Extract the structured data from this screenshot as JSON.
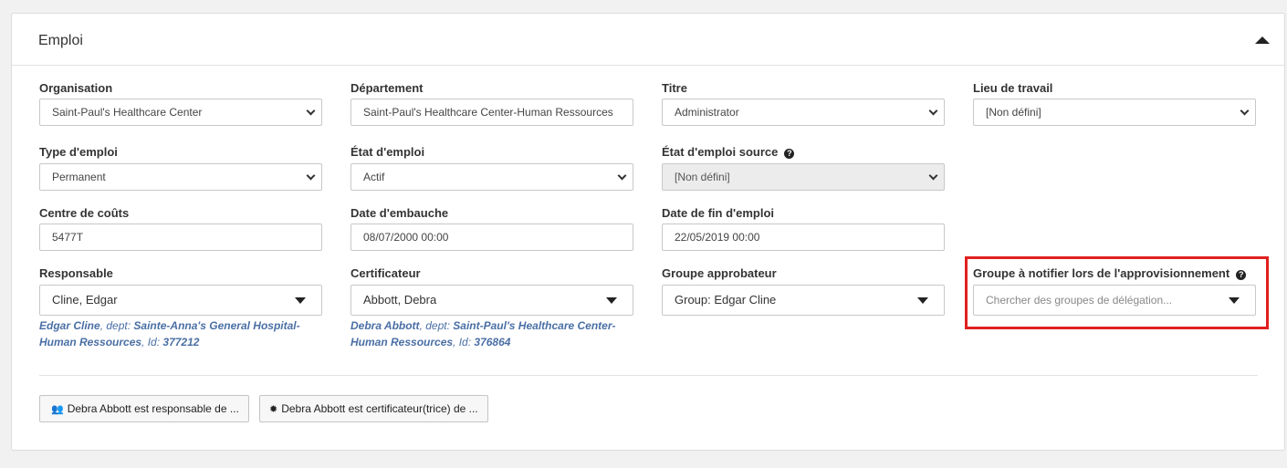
{
  "section": {
    "title": "Emploi"
  },
  "fields": {
    "organisation": {
      "label": "Organisation",
      "value": "Saint-Paul's Healthcare Center"
    },
    "departement": {
      "label": "Département",
      "value": "Saint-Paul's Healthcare Center-Human Ressources"
    },
    "titre": {
      "label": "Titre",
      "value": "Administrator"
    },
    "lieu": {
      "label": "Lieu de travail",
      "value": "[Non défini]"
    },
    "type_emploi": {
      "label": "Type d'emploi",
      "value": "Permanent"
    },
    "etat_emploi": {
      "label": "État d'emploi",
      "value": "Actif"
    },
    "etat_source": {
      "label": "État d'emploi source",
      "value": "[Non défini]"
    },
    "centre_couts": {
      "label": "Centre de coûts",
      "value": "5477T"
    },
    "date_embauche": {
      "label": "Date d'embauche",
      "value": "08/07/2000 00:00"
    },
    "date_fin": {
      "label": "Date de fin d'emploi",
      "value": "22/05/2019 00:00"
    },
    "responsable": {
      "label": "Responsable",
      "value": "Cline, Edgar",
      "info_name": "Edgar Cline",
      "info_dept_label": ", dept:",
      "info_dept": "Sainte-Anna's General Hospital-Human Ressources",
      "info_id_label": ", Id:",
      "info_id": "377212"
    },
    "certificateur": {
      "label": "Certificateur",
      "value": "Abbott, Debra",
      "info_name": "Debra Abbott",
      "info_dept_label": ", dept:",
      "info_dept": "Saint-Paul's Healthcare Center-Human Ressources",
      "info_id_label": ", Id:",
      "info_id": "376864"
    },
    "groupe_approbateur": {
      "label": "Groupe approbateur",
      "value": "Group: Edgar Cline"
    },
    "groupe_notifier": {
      "label": "Groupe à notifier lors de l'approvisionnement",
      "placeholder": "Chercher des groupes de délégation..."
    }
  },
  "buttons": {
    "responsable_de": "Debra Abbott est responsable de ...",
    "certificateur_de": "Debra Abbott est certificateur(trice) de ..."
  },
  "colors": {
    "highlight": "#e0201f",
    "info_link": "#4a6fa5"
  }
}
